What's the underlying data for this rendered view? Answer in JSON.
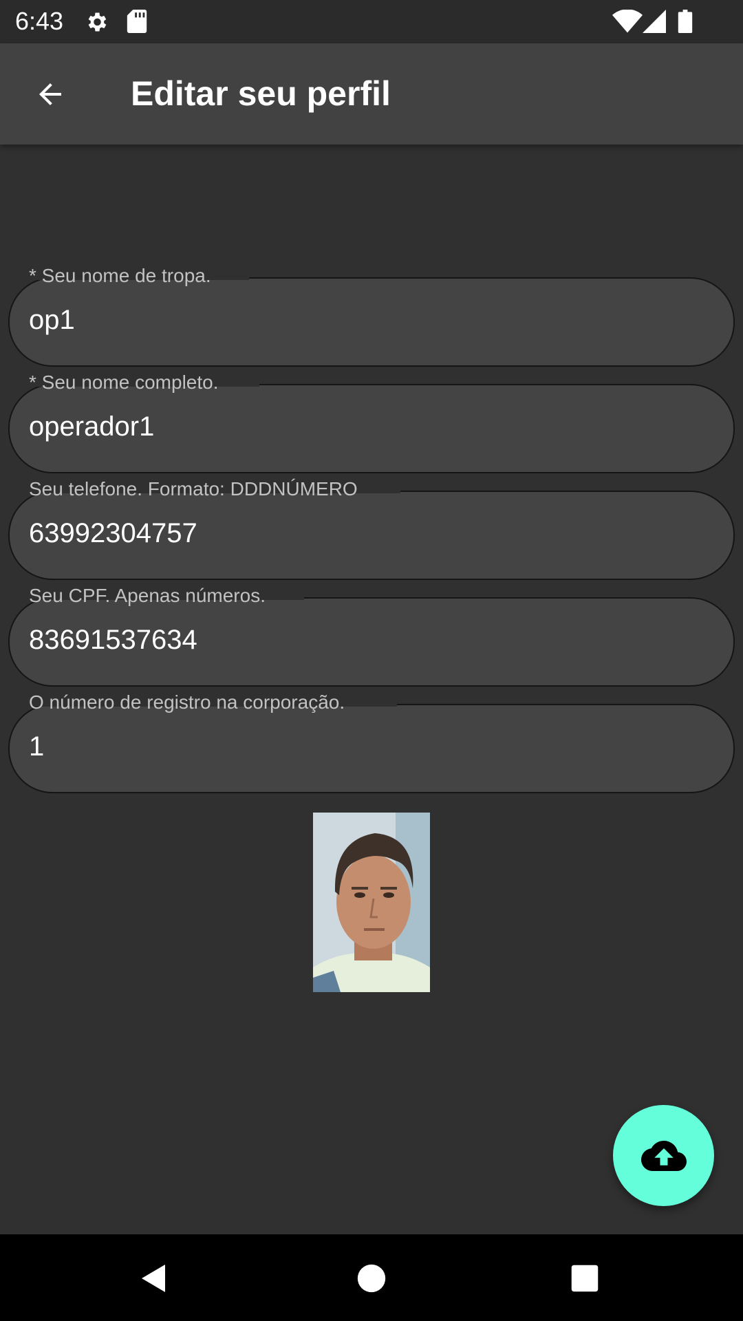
{
  "status_bar": {
    "time": "6:43",
    "icons": [
      "gear-icon",
      "sd-card-icon",
      "wifi-icon",
      "signal-icon",
      "battery-icon"
    ]
  },
  "app_bar": {
    "title": "Editar seu perfil",
    "back_icon": "arrow-back-icon"
  },
  "form": {
    "fields": [
      {
        "label": "* Seu nome de tropa.",
        "value": "op1"
      },
      {
        "label": "* Seu nome completo.",
        "value": "operador1"
      },
      {
        "label": "Seu telefone. Formato: DDDNÚMERO",
        "value": "63992304757"
      },
      {
        "label": "Seu CPF. Apenas números.",
        "value": "83691537634"
      },
      {
        "label": "O número de registro na corporação.",
        "value": "1"
      }
    ]
  },
  "fab": {
    "icon": "cloud-upload-icon"
  },
  "colors": {
    "background": "#303030",
    "app_bar": "#424242",
    "field_fill": "#444444",
    "accent": "#64ffda"
  },
  "nav_bar": {
    "icons": [
      "back-triangle-icon",
      "home-circle-icon",
      "recents-square-icon"
    ]
  }
}
